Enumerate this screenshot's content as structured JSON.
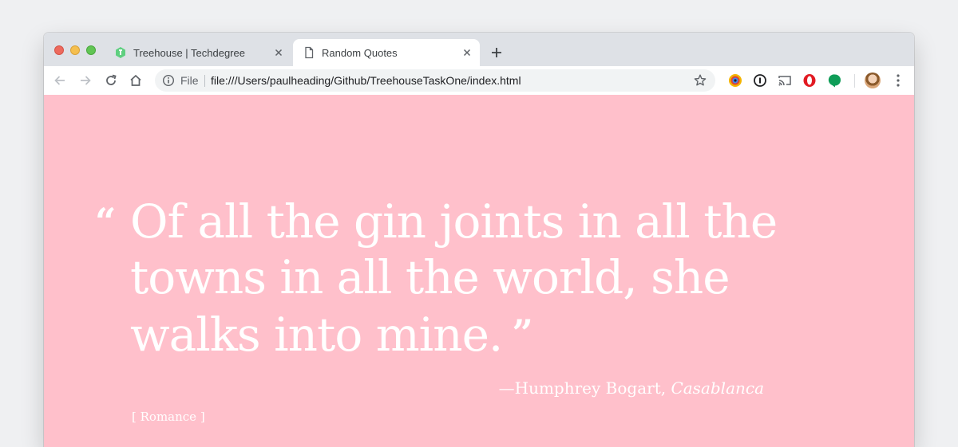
{
  "tabs": [
    {
      "title": "Treehouse | Techdegree",
      "favicon": "treehouse-icon",
      "active": false
    },
    {
      "title": "Random Quotes",
      "favicon": "document-icon",
      "active": true
    }
  ],
  "omnibox": {
    "scheme_label": "File",
    "url": "file:///Users/paulheading/Github/TreehouseTaskOne/index.html"
  },
  "page": {
    "background": "#ffc0cb",
    "quote_open": "“",
    "quote": "Of all the gin joints in all the towns in all the world, she walks into mine.",
    "quote_close": "”",
    "citation_prefix": "—Humphrey Bogart, ",
    "citation_source": "Casablanca",
    "tag": "[ Romance ]"
  },
  "colors": {
    "accent_green": "#0f9d58",
    "opera_red": "#e21b23"
  }
}
